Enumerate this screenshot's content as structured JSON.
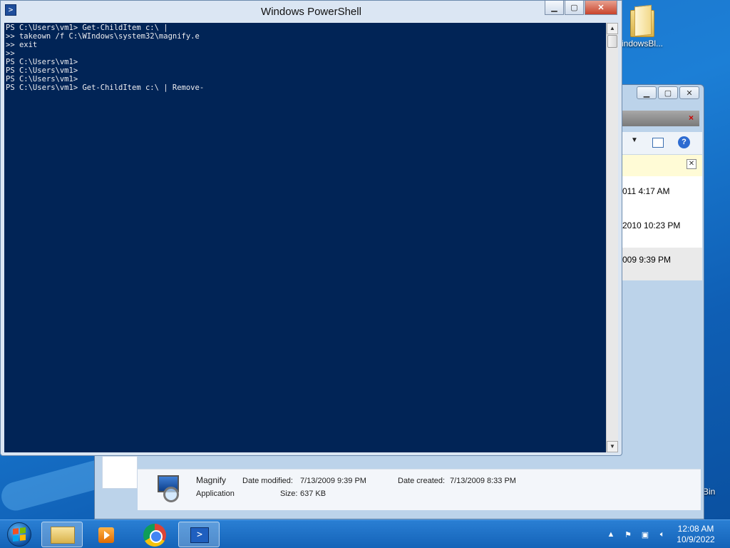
{
  "desktop": {
    "folder_label": "indowsBl...",
    "recycle_label": "Bin"
  },
  "explorer": {
    "rows": [
      {
        "text": "011 4:17 AM"
      },
      {
        "text": "2010 10:23 PM"
      },
      {
        "text": "009 9:39 PM"
      }
    ],
    "details": {
      "name": "Magnify",
      "type": "Application",
      "date_modified_label": "Date modified:",
      "date_modified": "7/13/2009 9:39 PM",
      "date_created_label": "Date created:",
      "date_created": "7/13/2009 8:33 PM",
      "size_label": "Size:",
      "size": "637 KB"
    }
  },
  "powershell": {
    "title": "Windows PowerShell",
    "console_lines": [
      "PS C:\\Users\\vm1> Get-ChildItem c:\\ |",
      ">> takeown /f C:\\WIndows\\system32\\magnify.e",
      ">> exit",
      ">>",
      "PS C:\\Users\\vm1>",
      "PS C:\\Users\\vm1>",
      "PS C:\\Users\\vm1>",
      "PS C:\\Users\\vm1> Get-ChildItem c:\\ | Remove-"
    ]
  },
  "taskbar": {
    "time": "12:08 AM",
    "date": "10/9/2022"
  },
  "colors": {
    "console_bg": "#012456",
    "console_fg": "#eeedf0",
    "taskbar": "#1463b8"
  }
}
